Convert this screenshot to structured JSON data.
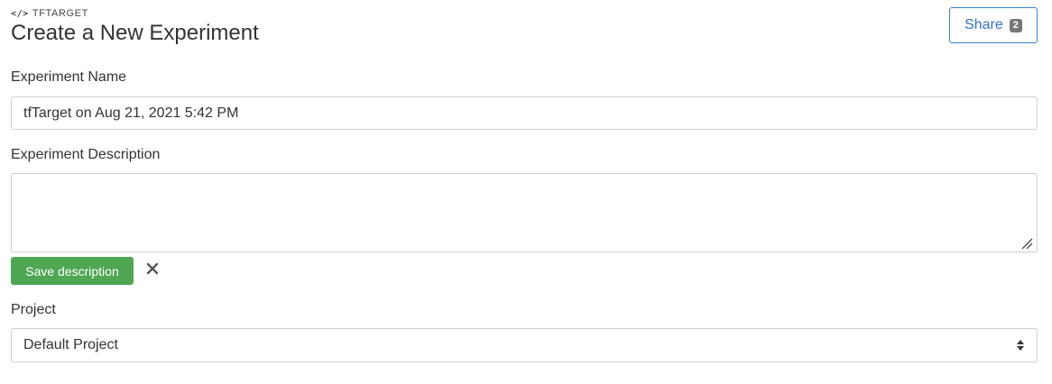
{
  "header": {
    "tool_tag": "TFTARGET",
    "tool_icon": "code-icon",
    "title": "Create a New Experiment"
  },
  "share": {
    "label": "Share",
    "count": "2",
    "accent_color": "#3b82d6"
  },
  "form": {
    "name": {
      "label": "Experiment Name",
      "value": "tfTarget on Aug 21, 2021 5:42 PM"
    },
    "description": {
      "label": "Experiment Description",
      "value": "",
      "save_label": "Save description",
      "save_color": "#4fa653",
      "cancel_icon": "close-icon"
    },
    "project": {
      "label": "Project",
      "selected": "Default Project",
      "icon": "select-arrows-icon"
    }
  }
}
